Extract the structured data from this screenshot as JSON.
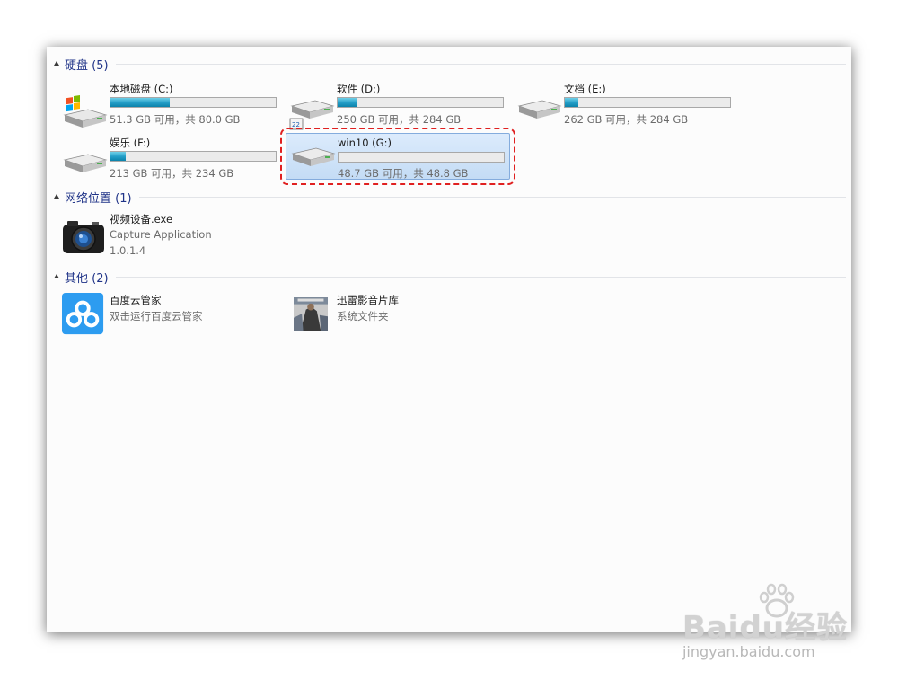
{
  "groups": {
    "drives": {
      "title": "硬盘 (5)"
    },
    "network": {
      "title": "网络位置 (1)"
    },
    "other": {
      "title": "其他 (2)"
    }
  },
  "drives": [
    {
      "name": "本地磁盘 (C:)",
      "size": "51.3 GB 可用，共 80.0 GB",
      "used_fraction": 0.36
    },
    {
      "name": "软件 (D:)",
      "size": "250 GB 可用，共 284 GB",
      "used_fraction": 0.12
    },
    {
      "name": "文档 (E:)",
      "size": "262 GB 可用，共 284 GB",
      "used_fraction": 0.08
    },
    {
      "name": "娱乐 (F:)",
      "size": "213 GB 可用，共 234 GB",
      "used_fraction": 0.09
    },
    {
      "name": "win10 (G:)",
      "size": "48.7 GB 可用，共 48.8 GB",
      "used_fraction": 0.005,
      "selected": true
    }
  ],
  "network_items": [
    {
      "name": "视频设备.exe",
      "desc": "Capture Application",
      "version": "1.0.1.4"
    }
  ],
  "other_items": [
    {
      "name": "百度云管家",
      "desc": "双击运行百度云管家"
    },
    {
      "name": "迅雷影音片库",
      "desc": "系统文件夹"
    }
  ],
  "watermark": {
    "brand": "Baidu经验",
    "url": "jingyan.baidu.com"
  },
  "colors": {
    "group_title": "#1e3287",
    "bar_fill": "#26a0c9",
    "selection_bg": "#c4dcf5",
    "highlight_outline": "#e02020"
  }
}
